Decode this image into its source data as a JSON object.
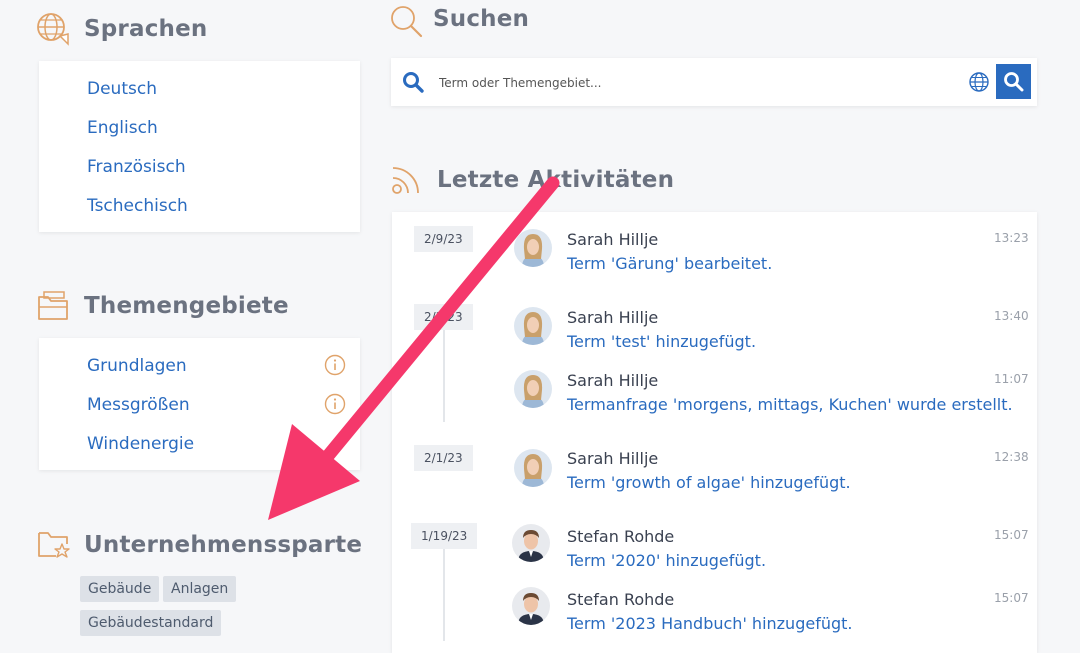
{
  "languages": {
    "title": "Sprachen",
    "items": [
      "Deutsch",
      "Englisch",
      "Französisch",
      "Tschechisch"
    ]
  },
  "topics": {
    "title": "Themengebiete",
    "items": [
      "Grundlagen",
      "Messgrößen",
      "Windenergie"
    ]
  },
  "division": {
    "title": "Unternehmenssparte",
    "tags": [
      "Gebäude",
      "Anlagen",
      "Gebäudestandard"
    ]
  },
  "search": {
    "title": "Suchen",
    "placeholder": "Term oder Themengebiet..."
  },
  "activities": {
    "title": "Letzte Aktivitäten",
    "dates": [
      "2/9/23",
      "2/3/23",
      "2/1/23",
      "1/19/23"
    ],
    "entries": [
      {
        "user": "Sarah Hillje",
        "text": "Term 'Gärung' bearbeitet.",
        "time": "13:23"
      },
      {
        "user": "Sarah Hillje",
        "text": "Term 'test' hinzugefügt.",
        "time": "13:40"
      },
      {
        "user": "Sarah Hillje",
        "text": "Termanfrage 'morgens, mittags, Kuchen' wurde erstellt.",
        "time": "11:07"
      },
      {
        "user": "Sarah Hillje",
        "text": "Term 'growth of algae' hinzugefügt.",
        "time": "12:38"
      },
      {
        "user": "Stefan Rohde",
        "text": "Term '2020' hinzugefügt.",
        "time": "15:07"
      },
      {
        "user": "Stefan Rohde",
        "text": "Term '2023 Handbuch' hinzugefügt.",
        "time": "15:07"
      }
    ]
  },
  "colors": {
    "accent": "#2a6bbf",
    "icon_orange": "#e0a36a",
    "arrow": "#f5386b"
  }
}
